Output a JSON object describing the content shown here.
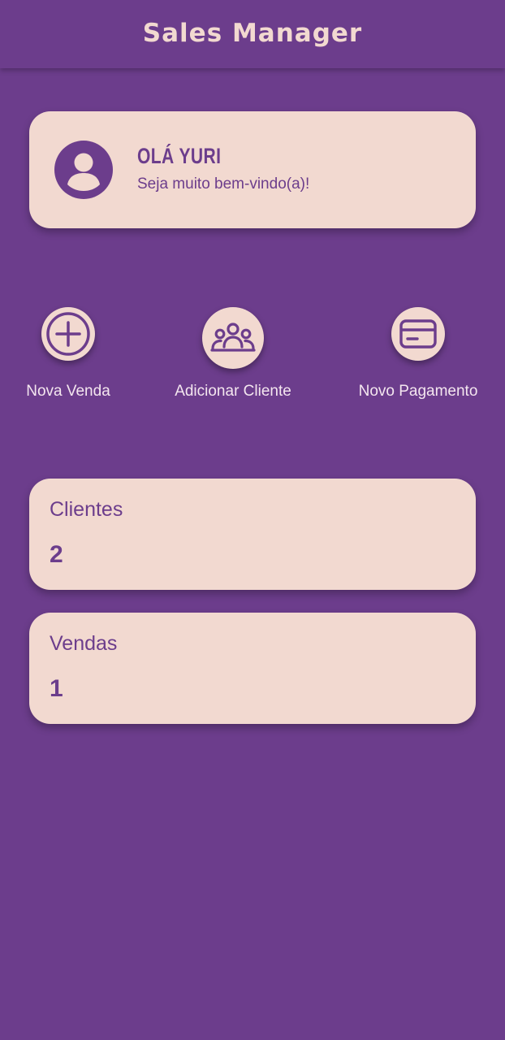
{
  "header": {
    "title": "Sales Manager"
  },
  "welcome": {
    "greeting": "OLÁ YURI",
    "subtitle": "Seja muito bem-vindo(a)!",
    "avatar_icon": "user-circle-icon"
  },
  "actions": [
    {
      "label": "Nova Venda",
      "icon": "plus-circle-icon"
    },
    {
      "label": "Adicionar Cliente",
      "icon": "users-group-icon"
    },
    {
      "label": "Novo Pagamento",
      "icon": "credit-card-icon"
    }
  ],
  "stats": {
    "clientes": {
      "label": "Clientes",
      "value": "2"
    },
    "vendas": {
      "label": "Vendas",
      "value": "1"
    }
  },
  "colors": {
    "background": "#6c3d8c",
    "card": "#f2d9d0",
    "accent": "#6c3d8c",
    "label_light": "#f4e6ef"
  }
}
